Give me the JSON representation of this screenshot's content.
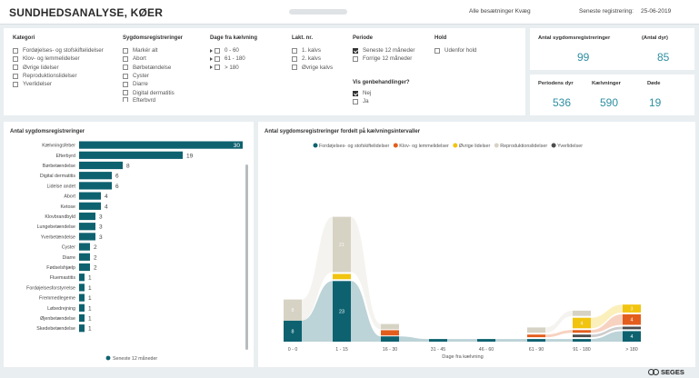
{
  "header": {
    "title": "SUNDHEDSANALYSE, KØER",
    "slicer_text": "Alle besætninger Kvæg",
    "reg_label": "Seneste registrering:",
    "reg_value": "25-06-2019"
  },
  "filters": {
    "kategori": {
      "heading": "Kategori",
      "options": [
        {
          "label": "Fordøjelses- og stofskiftelidelser",
          "checked": false
        },
        {
          "label": "Klov- og lemmelidelser",
          "checked": false
        },
        {
          "label": "Øvrige lidelser",
          "checked": false
        },
        {
          "label": "Reproduktionslidelser",
          "checked": false
        },
        {
          "label": "Yverlidelser",
          "checked": false
        }
      ]
    },
    "sygdom": {
      "heading": "Sygdomsregistreringer",
      "options": [
        {
          "label": "Markér alt",
          "checked": false
        },
        {
          "label": "Abort",
          "checked": false
        },
        {
          "label": "Børbetændelse",
          "checked": false
        },
        {
          "label": "Cyster",
          "checked": false
        },
        {
          "label": "Diarre",
          "checked": false
        },
        {
          "label": "Digital dermatitis",
          "checked": false
        },
        {
          "label": "Efterbyrd",
          "checked": false
        }
      ]
    },
    "dage": {
      "heading": "Dage fra kælvning",
      "options": [
        {
          "label": "0 - 60",
          "checked": false
        },
        {
          "label": "61 - 180",
          "checked": false
        },
        {
          "label": "> 180",
          "checked": false
        }
      ]
    },
    "lakt": {
      "heading": "Lakt. nr.",
      "options": [
        {
          "label": "1. kalvs",
          "checked": false
        },
        {
          "label": "2. kalvs",
          "checked": false
        },
        {
          "label": "Øvrige kalvs",
          "checked": false
        }
      ]
    },
    "periode": {
      "heading": "Periode",
      "options": [
        {
          "label": "Seneste 12 måneder",
          "checked": true
        },
        {
          "label": "Forrige 12 måneder",
          "checked": false
        }
      ]
    },
    "hold": {
      "heading": "Hold",
      "options": [
        {
          "label": "Udenfor hold",
          "checked": false
        }
      ]
    },
    "genbehandling": {
      "heading": "Vis genbehandlinger?",
      "options": [
        {
          "label": "Nej",
          "checked": true
        },
        {
          "label": "Ja",
          "checked": false
        }
      ]
    }
  },
  "kpis": {
    "reg_label": "Antal sygdomsregistreringer",
    "dyr_label": "(Antal dyr)",
    "reg_value": "99",
    "dyr_value": "85",
    "periode_label": "Periodens dyr",
    "kaelvninger_label": "Kælvninger",
    "doede_label": "Døde",
    "periode_value": "536",
    "kaelvninger_value": "590",
    "doede_value": "19"
  },
  "bar_chart": {
    "title": "Antal sygdomsregistreringer",
    "legend": "Seneste 12 måneder",
    "colors": {
      "bar": "#0e6270",
      "legend_dot": "#0e6270"
    }
  },
  "ribbon_chart": {
    "title": "Antal sygdomsregistreringer fordelt på kælvningsintervaller",
    "xlabel": "Dage fra kælvning"
  },
  "logo": {
    "text": "SEGES"
  },
  "chart_data": [
    {
      "type": "bar",
      "orientation": "horizontal",
      "title": "Antal sygdomsregistreringer",
      "categories": [
        "Kælvningsfeber",
        "Efterbyrd",
        "Børbetændelse",
        "Digital dermatitis",
        "Lidelse andet",
        "Abort",
        "Ketose",
        "Klovbrandbyld",
        "Lungebetændelse",
        "Yverbetændelse",
        "Cyster",
        "Diarre",
        "Fødselshjælp",
        "Fluemastitis",
        "Fordøjelsesforstyrrelse",
        "Fremmedlegeme",
        "Løbedrejning",
        "Øjenbetændelse",
        "Skedebetændelse"
      ],
      "values": [
        30,
        19,
        8,
        6,
        6,
        4,
        4,
        3,
        3,
        3,
        2,
        2,
        2,
        1,
        1,
        1,
        1,
        1,
        1
      ],
      "legend": [
        "Seneste 12 måneder"
      ],
      "xlim": [
        0,
        30
      ]
    },
    {
      "type": "bar",
      "stacked": true,
      "title": "Antal sygdomsregistreringer fordelt på kælvningsintervaller",
      "xlabel": "Dage fra kælvning",
      "categories": [
        "0 - 0",
        "1 - 15",
        "16 - 30",
        "31 - 45",
        "46 - 60",
        "61 - 90",
        "91 - 180",
        "> 180"
      ],
      "series": [
        {
          "name": "Fordøjelses- og stofskiftelidelser",
          "color": "#0e6270",
          "values": [
            8,
            23,
            2,
            1,
            1,
            1,
            1,
            4
          ]
        },
        {
          "name": "Klov- og lemmelidelser",
          "color": "#e35e1c",
          "values": [
            0,
            0,
            2,
            0,
            0,
            1,
            1,
            4
          ]
        },
        {
          "name": "Øvrige lidelser",
          "color": "#f1c40f",
          "values": [
            0,
            2,
            0,
            0,
            0,
            0,
            4,
            3
          ]
        },
        {
          "name": "Reproduktionslidelser",
          "color": "#d7d3c4",
          "values": [
            8,
            21,
            2,
            0,
            0,
            2,
            2,
            0
          ]
        },
        {
          "name": "Yverlidelser",
          "color": "#4d4d4d",
          "values": [
            0,
            0,
            0,
            0,
            0,
            0,
            1,
            1
          ]
        }
      ]
    }
  ]
}
